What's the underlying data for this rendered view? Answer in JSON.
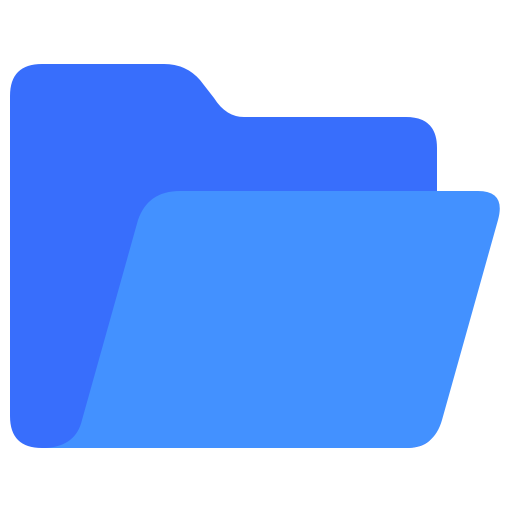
{
  "icon": {
    "name": "open-folder-icon",
    "colors": {
      "back": "#386EFC",
      "front": "#4391FF",
      "background": "#FFFFFF"
    }
  }
}
